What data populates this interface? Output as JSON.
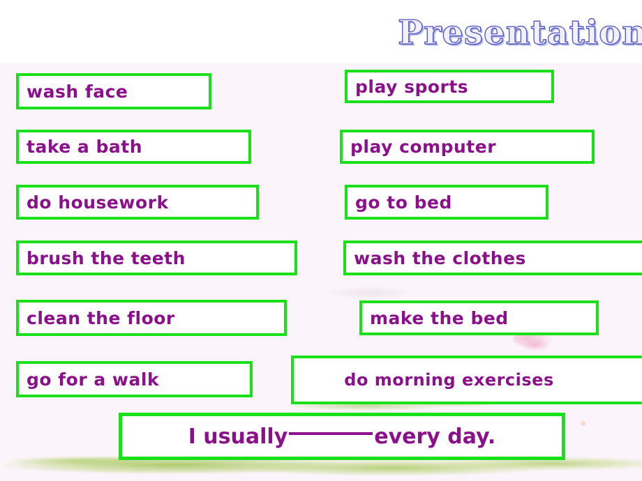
{
  "slide": {
    "title": "Presentation",
    "background_color": "#fbf4fa",
    "box_border_color": "#19e019",
    "text_color": "#8a1189",
    "title_color": "#5b5fc0"
  },
  "left_column": [
    {
      "label": "wash face"
    },
    {
      "label": "take a bath"
    },
    {
      "label": "do housework"
    },
    {
      "label": "brush the teeth"
    },
    {
      "label": "clean the floor"
    },
    {
      "label": "go for a walk"
    }
  ],
  "right_column": [
    {
      "label": "play sports"
    },
    {
      "label": "play computer"
    },
    {
      "label": "go to bed"
    },
    {
      "label": "wash the clothes"
    },
    {
      "label": "make the bed"
    },
    {
      "label": "do morning exercises"
    }
  ],
  "sentence": {
    "prefix": "I usually",
    "suffix": "every day."
  }
}
